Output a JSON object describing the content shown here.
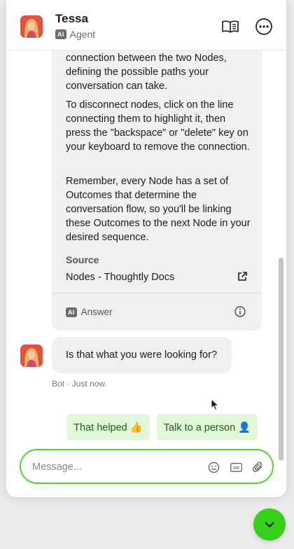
{
  "header": {
    "name": "Tessa",
    "badge": "AI",
    "role": "Agent"
  },
  "answer": {
    "paragraphs": [
      "connection between the two Nodes, defining the possible paths your conversation can take.",
      "To disconnect nodes, click on the line connecting them to highlight it, then press the \"backspace\" or \"delete\" key on your keyboard to remove the connection.",
      "Remember, every Node has a set of Outcomes that determine the conversation flow, so you'll be linking these Outcomes to the next Node in your desired sequence."
    ],
    "source_title": "Source",
    "source_link": "Nodes - Thoughtly Docs",
    "footer_badge": "AI",
    "footer_label": "Answer"
  },
  "question": {
    "text": "Is that what you were looking for?",
    "meta": "Bot · Just now."
  },
  "quick_replies": [
    "That helped 👍",
    "Talk to a person 👤"
  ],
  "composer": {
    "placeholder": "Message...",
    "gif_label": "GIF"
  },
  "colors": {
    "accent": "#4ed62a",
    "launcher": "#35d11a",
    "quick_reply_bg": "#e0f7d9",
    "bubble_bg": "#f0f0f0"
  },
  "icons": [
    "book-icon",
    "more-icon",
    "external-link-icon",
    "info-icon",
    "emoji-icon",
    "gif-icon",
    "paperclip-icon",
    "chevron-down-icon"
  ]
}
